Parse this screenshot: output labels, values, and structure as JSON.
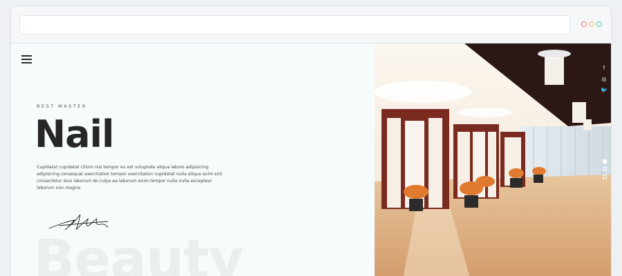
{
  "browser": {
    "controls": [
      {
        "name": "red-dot",
        "color": "#ff6b6b"
      },
      {
        "name": "yellow-dot",
        "color": "#f6c35b"
      },
      {
        "name": "green-dot",
        "color": "#3ecfa4"
      }
    ]
  },
  "hero": {
    "kicker": "BEST MASTER",
    "title": "Nail",
    "description": "Cupidatat cupidatat cillum nisi tempor eu est voluptate aliqua labore adipisicing adipisicing consequat exercitation tempor exercitation cupidatat nulla aliqua anim sint consectetur duis laborum do culpa ea laborum enim tempor nulla nulla excepteur laborum non magna.",
    "background_word": "Beauty"
  },
  "social": {
    "facebook": "f",
    "instagram": "◎",
    "twitter": "🐦"
  },
  "colors": {
    "accent": "#262626",
    "panel": "#f6fcfc"
  }
}
